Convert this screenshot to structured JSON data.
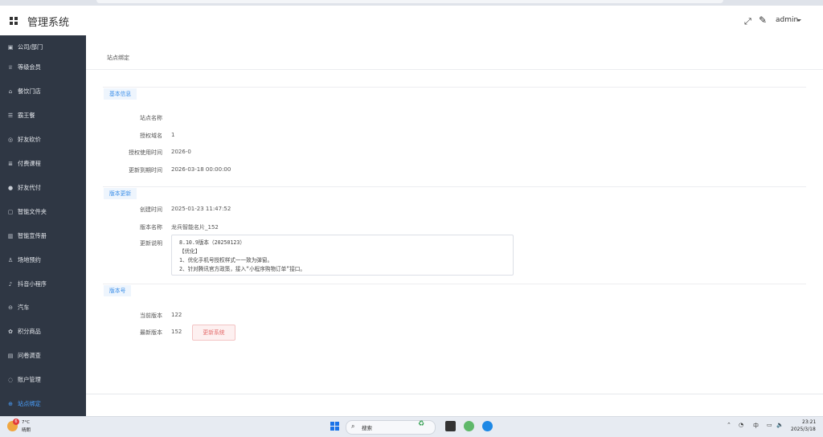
{
  "header": {
    "title": "管理系统",
    "user": "admin"
  },
  "sidebar": {
    "items": [
      {
        "label": "公司/部门",
        "icon": "building-icon"
      },
      {
        "label": "等级会员",
        "icon": "crown-icon"
      },
      {
        "label": "餐饮门店",
        "icon": "store-icon"
      },
      {
        "label": "霸王餐",
        "icon": "list-icon"
      },
      {
        "label": "好友砍价",
        "icon": "bargain-icon"
      },
      {
        "label": "付费课程",
        "icon": "course-icon"
      },
      {
        "label": "好友代付",
        "icon": "payment-icon"
      },
      {
        "label": "智能文件夹",
        "icon": "folder-icon"
      },
      {
        "label": "智能宣传册",
        "icon": "brochure-icon"
      },
      {
        "label": "场地预约",
        "icon": "person-icon"
      },
      {
        "label": "抖音小程序",
        "icon": "tiktok-icon"
      },
      {
        "label": "汽车",
        "icon": "car-icon"
      },
      {
        "label": "积分商品",
        "icon": "points-icon"
      },
      {
        "label": "问卷调查",
        "icon": "survey-icon"
      },
      {
        "label": "账户管理",
        "icon": "account-icon"
      },
      {
        "label": "站点绑定",
        "icon": "globe-icon"
      }
    ]
  },
  "content": {
    "breadcrumb": "站点绑定",
    "basic": {
      "title": "基本信息",
      "site_name_label": "站点名称",
      "site_name_value": "",
      "domain_label": "授权域名",
      "domain_value": "1",
      "use_time_label": "授权使用时间",
      "use_time_value": "2026-0",
      "expire_label": "更新到期时间",
      "expire_value": "2026-03-18 00:00:00"
    },
    "update": {
      "title": "版本更新",
      "created_label": "创建时间",
      "created_value": "2025-01-23 11:47:52",
      "version_name_label": "版本名称",
      "version_name_value": "龙兵智能名片_152",
      "notes_label": "更新说明",
      "notes": [
        "8.10.9版本（20250123）",
        "【优化】",
        "1、优化手机号授权样式一一致为弹窗。",
        "2、针对腾讯官方政策，接入“小程序购物订单”接口。"
      ]
    },
    "version": {
      "title": "版本号",
      "current_label": "当前版本",
      "current_value": "122",
      "latest_label": "最新版本",
      "latest_value": "152",
      "update_button": "更新系统"
    }
  },
  "taskbar": {
    "weather_badge": "6",
    "weather_temp": "7°C",
    "weather_desc": "晴朗",
    "search": "搜索",
    "ime_lang": "中",
    "clock_time": "23:21",
    "clock_date": "2025/3/18"
  }
}
